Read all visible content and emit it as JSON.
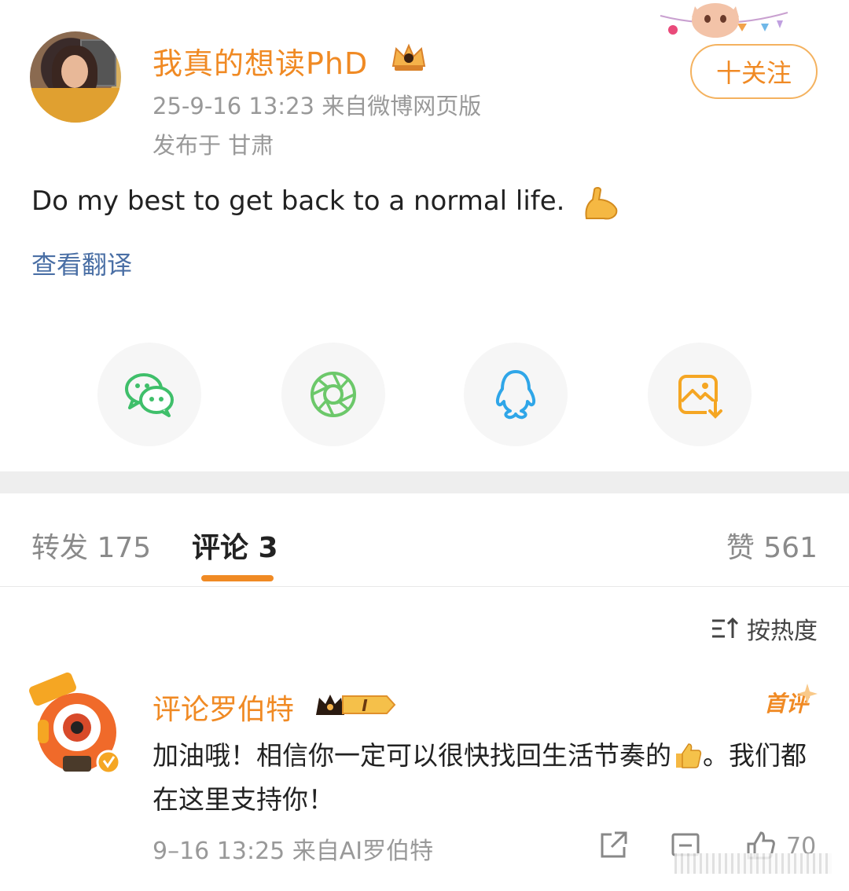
{
  "post": {
    "username": "我真的想读PhD",
    "timestamp_source": "25-9-16 13:23  来自微博网页版",
    "location": "发布于 甘肃",
    "follow_label": "十关注",
    "text": "Do my best to get back to a normal life.",
    "translate_label": "查看翻译"
  },
  "share": {
    "items": [
      {
        "name": "wechat",
        "icon": "wechat-icon",
        "color": "#3fbf6a"
      },
      {
        "name": "moments",
        "icon": "camera-aperture-icon",
        "color": "#6cc86a"
      },
      {
        "name": "qq",
        "icon": "qq-penguin-icon",
        "color": "#2fa6e8"
      },
      {
        "name": "save-image",
        "icon": "image-download-icon",
        "color": "#f5a623"
      }
    ]
  },
  "tabs": {
    "repost": "转发 175",
    "comments": "评论 3",
    "likes": "赞 561"
  },
  "sort": {
    "label": "按热度"
  },
  "comment": {
    "author": "评论罗伯特",
    "badge_level": "I",
    "first_tag": "首评",
    "text_part1": "加油哦！相信你一定可以很快找回生活节奏的",
    "text_part2": "。我们都在这里支持你！",
    "meta": "9–16 13:25  来自AI罗伯特",
    "like_count": "70"
  },
  "colors": {
    "accent": "#f08a24",
    "link": "#4a6fa5",
    "muted": "#999999"
  }
}
